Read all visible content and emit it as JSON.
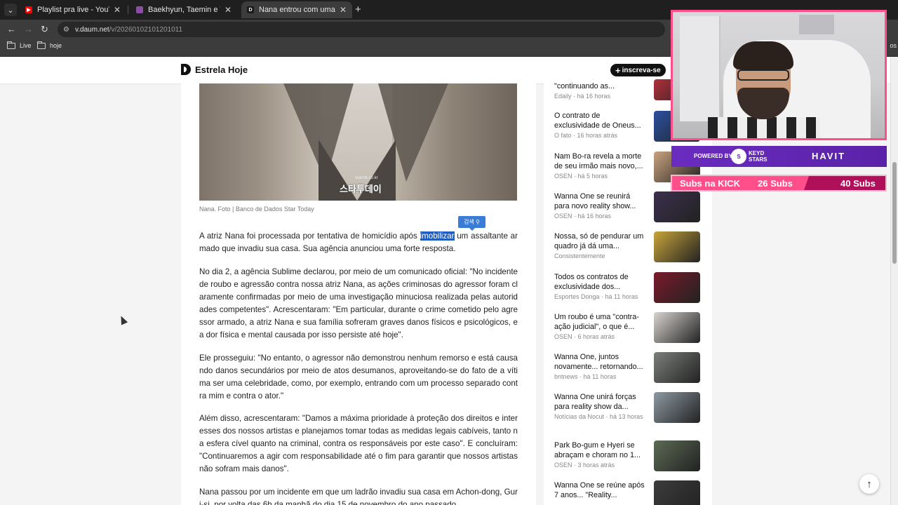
{
  "browser": {
    "tabs": [
      {
        "title": "Playlist pra live - YouTube",
        "favicon_color": "#ff0000"
      },
      {
        "title": "Baekhyun, Taemin e THE BOYZ",
        "favicon_color": "#8a4fa3"
      },
      {
        "title": "Nana entrou com uma contra-",
        "favicon_color": "#1a1a1a",
        "favicon_letter": "D",
        "active": true
      }
    ],
    "url_domain": "v.daum.net",
    "url_path": "/v/20260102101201011",
    "bookmarks": [
      "Live",
      "hoje"
    ],
    "bookmarks_right": "os"
  },
  "site": {
    "name": "Estrela Hoje",
    "subscribe_label": "inscreva-se"
  },
  "article": {
    "photo_watermark": "스타투데이",
    "photo_watermark_small": "starmk.co.kr",
    "caption": "Nana. Foto | Banco de Dados Star Today",
    "search_popup": "검색",
    "p1_before": "A atriz Nana foi processada por tentativa de homicídio após ",
    "p1_highlight": "imobilizar",
    "p1_after": " um assaltante armado que invadiu sua casa. Sua agência anunciou uma forte resposta.",
    "p2": "No dia 2, a agência Sublime declarou, por meio de um comunicado oficial: \"No incidente de roubo e agressão contra nossa atriz Nana, as ações criminosas do agressor foram claramente confirmadas por meio de uma investigação minuciosa realizada pelas autoridades competentes\". Acrescentaram: \"Em particular, durante o crime cometido pelo agressor armado, a atriz Nana e sua família sofreram graves danos físicos e psicológicos, e a dor física e mental causada por isso persiste até hoje\".",
    "p3": "Ele prosseguiu: \"No entanto, o agressor não demonstrou nenhum remorso e está causando danos secundários por meio de atos desumanos, aproveitando-se do fato de a vítima ser uma celebridade, como, por exemplo, entrando com um processo separado contra mim e contra o ator.\"",
    "p4": "Além disso, acrescentaram: \"Damos a máxima prioridade à proteção dos direitos e interesses dos nossos artistas e planejamos tomar todas as medidas legais cabíveis, tanto na esfera cível quanto na criminal, contra os responsáveis por este caso\". E concluíram: \"Continuaremos a agir com responsabilidade até o fim para garantir que nossos artistas não sofram mais danos\".",
    "p5": "Nana passou por um incidente em que um ladrão invadiu sua casa em Achon-dong, Guri-si, por volta das 6h da manhã do dia 15 de novembro do ano passado."
  },
  "sidebar": [
    {
      "title": "\"continuando as...",
      "meta": "Edaily · há 16 horas",
      "thumb": "#b0303a"
    },
    {
      "title": "O contrato de exclusividade de Oneus...",
      "meta": "O fato · 16 horas atrás",
      "thumb": "#2a4fa0"
    },
    {
      "title": "Nam Bo-ra revela a morte de seu irmão mais novo,...",
      "meta": "OSEN · há 5 horas",
      "thumb": "#c9a27f"
    },
    {
      "title": "Wanna One se reunirá para novo reality show...",
      "meta": "OSEN · há 16 horas",
      "thumb": "#3b2f4d"
    },
    {
      "title": "Nossa, só de pendurar um quadro já dá uma...",
      "meta": "Consistentemente",
      "thumb": "#c8a43a"
    },
    {
      "title": "Todos os contratos de exclusividade dos...",
      "meta": "Esportes Donga · há 11 horas",
      "thumb": "#7a1a2a"
    },
    {
      "title": "Um roubo é uma \"contra-ação judicial\", o que é...",
      "meta": "OSEN · 6 horas atrás",
      "thumb": "#d7d3cf"
    },
    {
      "title": "Wanna One, juntos novamente... retornando...",
      "meta": "bntnews · há 11 horas",
      "thumb": "#7b7f7a"
    },
    {
      "title": "Wanna One unirá forças para reality show da...",
      "meta": "Notícias da Nocut · há 13 horas",
      "thumb": "#8e9aa3"
    },
    {
      "title": "Park Bo-gum e Hyeri se abraçam e choram no 1...",
      "meta": "OSEN · 3 horas atrás",
      "thumb": "#5c6b55"
    },
    {
      "title": "Wanna One se reúne após 7 anos... \"Reality...",
      "meta": "",
      "thumb": "#3c3c3c"
    }
  ],
  "overlay": {
    "powered_by": "POWERED BY",
    "badge_text": "S",
    "brand_line1": "KEYD",
    "brand_line2": "STARS",
    "sponsor_brand": "HAVIT",
    "subs_label": "Subs na KICK",
    "subs_current": "26 Subs",
    "subs_goal": "40 Subs"
  }
}
